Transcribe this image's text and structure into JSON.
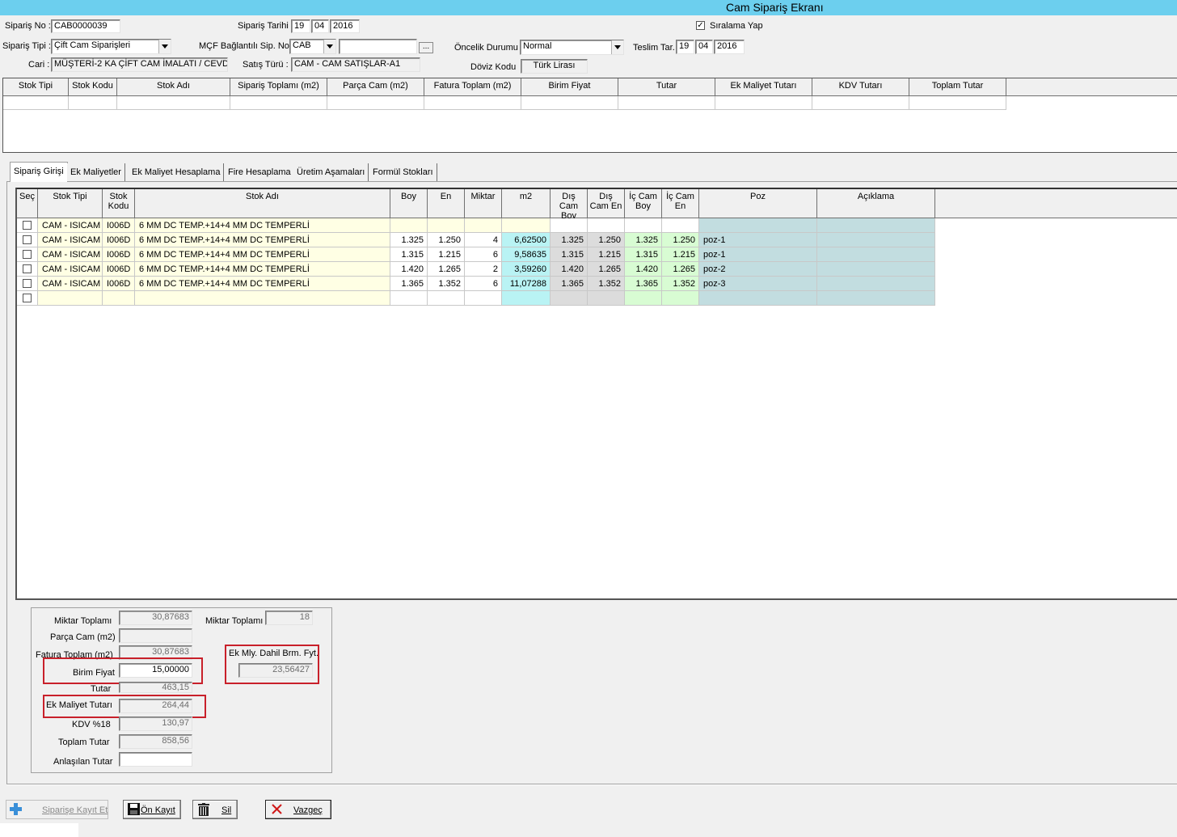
{
  "window": {
    "title": "Cam Sipariş Ekranı"
  },
  "header": {
    "siparis_no_label": "Sipariş No :",
    "siparis_no": "CAB0000039",
    "siparis_tarihi_label": "Sipariş Tarihi",
    "siparis_tarihi": {
      "day": "19",
      "month": "04",
      "year": "2016"
    },
    "siralama_label": "Sıralama Yap",
    "siralama_checked_mark": "✓",
    "siparis_tipi_label": "Sipariş Tipi :",
    "siparis_tipi": "Çift Cam Siparişleri",
    "mcf_label": "MÇF Bağlantılı Sip. No:",
    "mcf_prefix": "CAB",
    "mcf_value": "",
    "mcf_button": "...",
    "oncelik_label": "Öncelik Durumu",
    "oncelik": "Normal",
    "teslim_label": "Teslim Tar.",
    "teslim_tarihi": {
      "day": "19",
      "month": "04",
      "year": "2016"
    },
    "cari_label": "Cari :",
    "cari": "MÜŞTERİ-2 KA ÇİFT CAM İMALATI / CEVD",
    "satis_turu_label": "Satış Türü :",
    "satis_turu": "CAM - CAM SATIŞLAR-A1",
    "doviz_label": "Döviz Kodu",
    "doviz": "Türk Lirası"
  },
  "summary_grid": {
    "columns": [
      "Stok Tipi",
      "Stok Kodu",
      "Stok Adı",
      "Sipariş Toplamı (m2)",
      "Parça Cam (m2)",
      "Fatura Toplam (m2)",
      "Birim Fiyat",
      "Tutar",
      "Ek Maliyet Tutarı",
      "KDV Tutarı",
      "Toplam Tutar"
    ]
  },
  "tabs": [
    "Sipariş Girişi",
    "Ek Maliyetler",
    "Ek Maliyet Hesaplama",
    "Fire Hesaplama",
    "Üretim Aşamaları",
    "Formül Stokları"
  ],
  "order_grid": {
    "columns": [
      "Seç",
      "Stok Tipi",
      "Stok Kodu",
      "Stok Adı",
      "Boy",
      "En",
      "Miktar",
      "m2",
      "Dış Cam Boy",
      "Dış Cam En",
      "İç Cam Boy",
      "İç Cam En",
      "Poz",
      "Açıklama"
    ],
    "rows": [
      [
        "",
        "CAM - ISICAM",
        "I006D",
        "6 MM DC TEMP.+14+4 MM DC TEMPERLİ",
        "",
        "",
        "",
        "",
        "",
        "",
        "",
        "",
        "",
        ""
      ],
      [
        "",
        "CAM - ISICAM",
        "I006D",
        "6 MM DC TEMP.+14+4 MM DC TEMPERLİ",
        "1.325",
        "1.250",
        "4",
        "6,62500",
        "1.325",
        "1.250",
        "1.325",
        "1.250",
        "poz-1",
        ""
      ],
      [
        "",
        "CAM - ISICAM",
        "I006D",
        "6 MM DC TEMP.+14+4 MM DC TEMPERLİ",
        "1.315",
        "1.215",
        "6",
        "9,58635",
        "1.315",
        "1.215",
        "1.315",
        "1.215",
        "poz-1",
        ""
      ],
      [
        "",
        "CAM - ISICAM",
        "I006D",
        "6 MM DC TEMP.+14+4 MM DC TEMPERLİ",
        "1.420",
        "1.265",
        "2",
        "3,59260",
        "1.420",
        "1.265",
        "1.420",
        "1.265",
        "poz-2",
        ""
      ],
      [
        "",
        "CAM - ISICAM",
        "I006D",
        "6 MM DC TEMP.+14+4 MM DC TEMPERLİ",
        "1.365",
        "1.352",
        "6",
        "11,07288",
        "1.365",
        "1.352",
        "1.365",
        "1.352",
        "poz-3",
        ""
      ],
      [
        "",
        "",
        "",
        "",
        "",
        "",
        "",
        "",
        "",
        "",
        "",
        "",
        "",
        ""
      ]
    ]
  },
  "totals": {
    "miktar_toplami_label": "Miktar Toplamı",
    "miktar_toplami": "30,87683",
    "miktar_toplami2_label": "Miktar Toplamı",
    "miktar_toplami2": "18",
    "parca_cam_label": "Parça Cam (m2)",
    "parca_cam": "",
    "fatura_toplam_label": "Fatura Toplam (m2)",
    "fatura_toplam": "30,87683",
    "ek_mly_dahil_label": "Ek Mly. Dahil Brm. Fyt.",
    "ek_mly_dahil": "23,56427",
    "birim_fiyat_label": "Birim Fiyat",
    "birim_fiyat": "15,00000",
    "tutar_label": "Tutar",
    "tutar": "463,15",
    "ek_maliyet_label": "Ek Maliyet Tutarı",
    "ek_maliyet": "264,44",
    "kdv_label": "KDV %18",
    "kdv": "130,97",
    "toplam_tutar_label": "Toplam Tutar",
    "toplam_tutar": "858,56",
    "anlasilan_label": "Anlaşılan Tutar",
    "anlasilan": ""
  },
  "buttons": {
    "kayit": "Siparişe Kayıt Et",
    "on_kayit": "Ön Kayıt",
    "sil": "Sil",
    "vazgec": "Vazgeç"
  },
  "colors": {
    "titlebar": "#6ccfee",
    "highlight_red": "#c8202a",
    "cell_yellow": "#ffffe4",
    "cell_cyan": "#b9f3f4",
    "cell_grey": "#dcdcdc",
    "cell_green": "#d8fcd3",
    "cell_teal": "#c2dde0"
  }
}
